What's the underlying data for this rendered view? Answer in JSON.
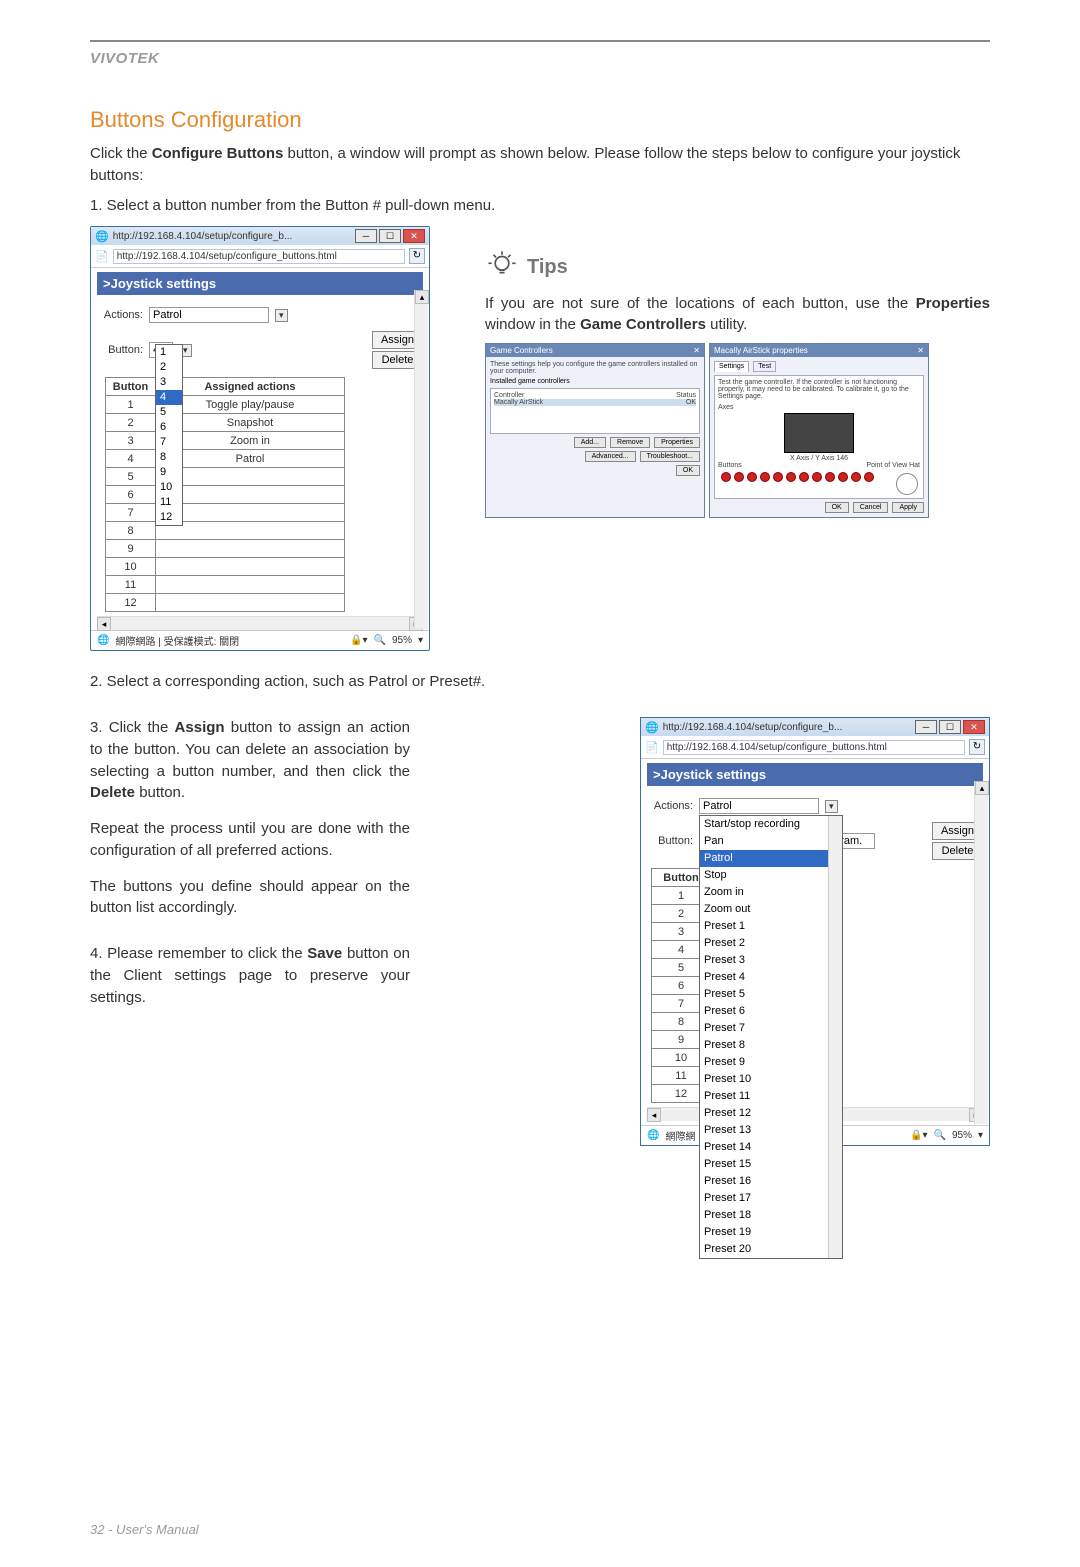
{
  "header": {
    "brand": "VIVOTEK"
  },
  "section_title": "Buttons Configuration",
  "intro": {
    "line1_a": "Click the ",
    "line1_b": "Configure Buttons",
    "line1_c": " button, a window will prompt as shown below. Please follow the steps below to configure your joystick buttons:",
    "step1": "1. Select a button number from the Button # pull-down menu."
  },
  "win1": {
    "title_short": "http://192.168.4.104/setup/configure_b...",
    "url": "http://192.168.4.104/setup/configure_buttons.html",
    "heading": ">Joystick settings",
    "actions_label": "Actions:",
    "actions_value": "Patrol",
    "button_label": "Button:",
    "button_value": "4",
    "assign_btn": "Assign",
    "delete_btn": "Delete",
    "table_headers": [
      "Button",
      "Assigned actions"
    ],
    "table_rows": [
      {
        "n": "1",
        "a": "Toggle play/pause"
      },
      {
        "n": "2",
        "a": "Snapshot"
      },
      {
        "n": "3",
        "a": "Zoom in"
      },
      {
        "n": "4",
        "a": "Patrol"
      },
      {
        "n": "5",
        "a": ""
      },
      {
        "n": "6",
        "a": ""
      },
      {
        "n": "7",
        "a": ""
      },
      {
        "n": "8",
        "a": ""
      },
      {
        "n": "9",
        "a": ""
      },
      {
        "n": "10",
        "a": ""
      },
      {
        "n": "11",
        "a": ""
      },
      {
        "n": "12",
        "a": ""
      }
    ],
    "dropdown_items": [
      "1",
      "2",
      "3",
      "4",
      "5",
      "6",
      "7",
      "8",
      "9",
      "10",
      "11",
      "12"
    ],
    "dropdown_selected": "4",
    "status_left": "網際網路 | 受保護模式: 關閉",
    "zoom": "95%"
  },
  "tips": {
    "title": "Tips",
    "body_a": "If you are not sure of the locations of each button, use the ",
    "body_b": "Properties",
    "body_c": " window in the ",
    "body_d": "Game Controllers",
    "body_e": " utility."
  },
  "gc": {
    "title1": "Game Controllers",
    "desc": "These settings help you configure the game controllers installed on your computer.",
    "installed": "Installed game controllers",
    "controller": "Controller",
    "status": "Status",
    "controller_name": "Macally AirStick",
    "status_ok": "OK",
    "add": "Add...",
    "remove": "Remove",
    "properties": "Properties",
    "advanced": "Advanced...",
    "troubleshoot": "Troubleshoot...",
    "ok": "OK",
    "title2": "Macally AirStick properties",
    "tab_settings": "Settings",
    "tab_test": "Test",
    "test_desc": "Test the game controller. If the controller is not functioning properly, it may need to be calibrated. To calibrate it, go to the Settings page.",
    "axes": "Axes",
    "axes_pos": "X Axis / Y Axis   146",
    "buttons": "Buttons",
    "pov": "Point of View Hat",
    "cancel": "Cancel",
    "apply": "Apply"
  },
  "step2": "2. Select a corresponding action, such as Patrol or Preset#.",
  "step3": {
    "p1_a": "3. Click the ",
    "p1_b": "Assign",
    "p1_c": " button to assign an action to the button. You can delete an association by selecting a button number, and then click the ",
    "p1_d": "Delete",
    "p1_e": " button.",
    "p2": "Repeat the process until you are done with the configuration of all preferred actions.",
    "p3": "The buttons you define should appear on the button list accordingly.",
    "p4_a": "4. Please remember to click the ",
    "p4_b": "Save",
    "p4_c": " button on the Client settings page to preserve your settings."
  },
  "win2": {
    "title_short": "http://192.168.4.104/setup/configure_b...",
    "url": "http://192.168.4.104/setup/configure_buttons.html",
    "heading": ">Joystick settings",
    "actions_label": "Actions:",
    "actions_value": "Patrol",
    "button_label": "Button:",
    "param_value": "param.",
    "assign_btn": "Assign",
    "delete_btn": "Delete",
    "table_header": "Button",
    "table_rows": [
      "1",
      "2",
      "3",
      "4",
      "5",
      "6",
      "7",
      "8",
      "9",
      "10",
      "11",
      "12"
    ],
    "actions_list": [
      "Start/stop recording",
      "Pan",
      "Patrol",
      "Stop",
      "Zoom in",
      "Zoom out",
      "Preset 1",
      "Preset 2",
      "Preset 3",
      "Preset 4",
      "Preset 5",
      "Preset 6",
      "Preset 7",
      "Preset 8",
      "Preset 9",
      "Preset 10",
      "Preset 11",
      "Preset 12",
      "Preset 13",
      "Preset 14",
      "Preset 15",
      "Preset 16",
      "Preset 17",
      "Preset 18",
      "Preset 19",
      "Preset 20"
    ],
    "actions_selected": "Patrol",
    "status_left": "網際網",
    "zoom": "95%"
  },
  "footer": "32 - User's Manual"
}
